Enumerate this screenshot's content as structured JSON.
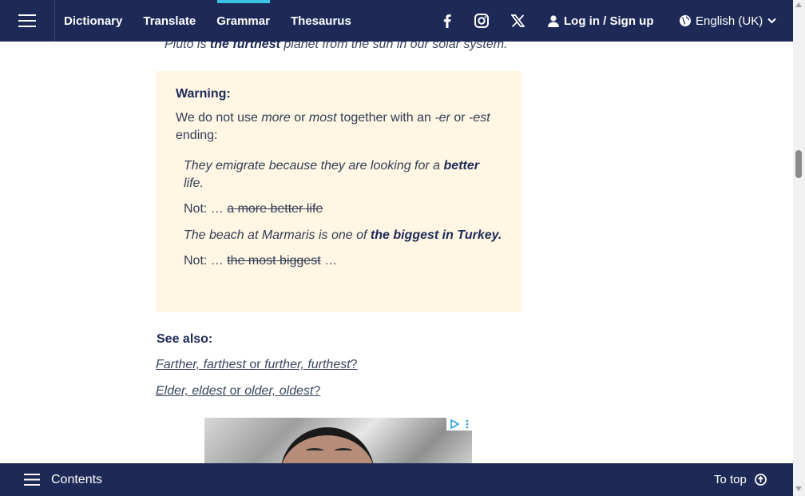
{
  "nav": {
    "links": [
      "Dictionary",
      "Translate",
      "Grammar",
      "Thesaurus"
    ],
    "active_link": "Grammar",
    "login_label": "Log in / Sign up",
    "language_label": "English (UK)",
    "accent_color": "#3cc2e5",
    "bar_color": "#1d2a57"
  },
  "article": {
    "top_example": {
      "pre": "Pluto is ",
      "bold": "the furthest",
      "post": " planet from the sun in our solar system."
    },
    "warning": {
      "title": "Warning:",
      "desc_parts": [
        "We do not use ",
        "more",
        " or ",
        "most",
        " together with an ",
        "-er",
        " or ",
        "-est",
        " ending:"
      ],
      "example1": {
        "pre": "They emigrate because they are looking for a ",
        "bold": "better",
        "post": " life."
      },
      "not1": {
        "prefix": "Not: … ",
        "struck": "a more better life",
        "suffix": ""
      },
      "example2": {
        "pre": "The beach at Marmaris is one of ",
        "bold": "the biggest in Turkey.",
        "post": ""
      },
      "not2": {
        "prefix": "Not: … ",
        "struck": "the most biggest",
        "suffix": " …"
      },
      "background_color": "#fff7e4"
    },
    "see_also": {
      "title": "See also:",
      "link1": {
        "a": "Farther, farthest",
        "or": " or ",
        "b": "further, furthest",
        "q": "?"
      },
      "link2": {
        "a": "Elder, eldest",
        "or": " or ",
        "b": "older, oldest",
        "q": "?"
      }
    }
  },
  "bottom": {
    "contents_label": "Contents",
    "totop_label": "To top"
  }
}
